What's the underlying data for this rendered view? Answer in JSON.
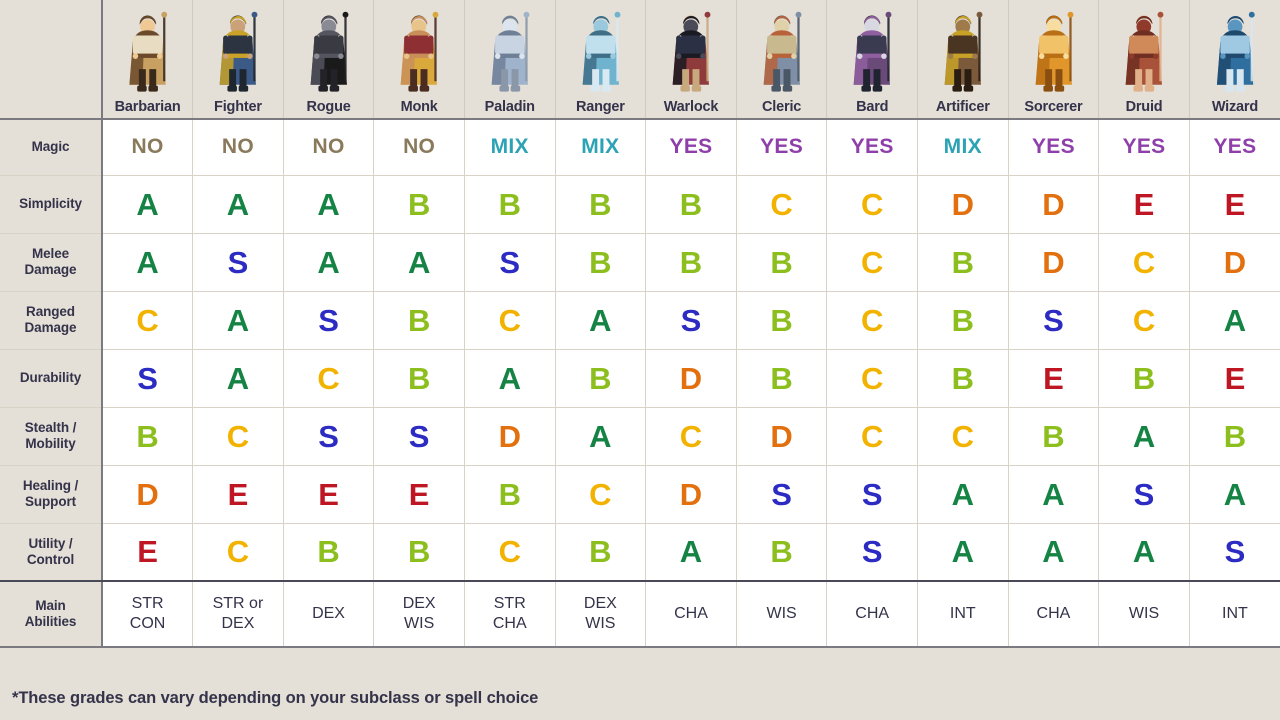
{
  "footnote": "*These grades can vary depending on your subclass or spell choice",
  "row_header_label": "",
  "classes": [
    {
      "name": "Barbarian",
      "icon": "barbarian-portrait"
    },
    {
      "name": "Fighter",
      "icon": "fighter-portrait"
    },
    {
      "name": "Rogue",
      "icon": "rogue-portrait"
    },
    {
      "name": "Monk",
      "icon": "monk-portrait"
    },
    {
      "name": "Paladin",
      "icon": "paladin-portrait"
    },
    {
      "name": "Ranger",
      "icon": "ranger-portrait"
    },
    {
      "name": "Warlock",
      "icon": "warlock-portrait"
    },
    {
      "name": "Cleric",
      "icon": "cleric-portrait"
    },
    {
      "name": "Bard",
      "icon": "bard-portrait"
    },
    {
      "name": "Artificer",
      "icon": "artificer-portrait"
    },
    {
      "name": "Sorcerer",
      "icon": "sorcerer-portrait"
    },
    {
      "name": "Druid",
      "icon": "druid-portrait"
    },
    {
      "name": "Wizard",
      "icon": "wizard-portrait"
    }
  ],
  "row_labels": {
    "magic": "Magic",
    "simplicity": "Simplicity",
    "melee": [
      "Melee",
      "Damage"
    ],
    "ranged": [
      "Ranged",
      "Damage"
    ],
    "durability": "Durability",
    "stealth": [
      "Stealth /",
      "Mobility"
    ],
    "healing": [
      "Healing /",
      "Support"
    ],
    "utility": [
      "Utility /",
      "Control"
    ],
    "abilities": [
      "Main",
      "Abilities"
    ]
  },
  "value_colors": {
    "S": "#2c2cc2",
    "A": "#158344",
    "B": "#8cbf1e",
    "C": "#f2b300",
    "D": "#e2700e",
    "E": "#be1622",
    "NO": "#8a7a5c",
    "MIX": "#2ba3b5",
    "YES": "#8e3faa"
  },
  "chart_data": {
    "type": "table",
    "title": "D&D Class Comparison Grades",
    "categories": [
      "Barbarian",
      "Fighter",
      "Rogue",
      "Monk",
      "Paladin",
      "Ranger",
      "Warlock",
      "Cleric",
      "Bard",
      "Artificer",
      "Sorcerer",
      "Druid",
      "Wizard"
    ],
    "rows": [
      {
        "label": "Magic",
        "values": [
          "NO",
          "NO",
          "NO",
          "NO",
          "MIX",
          "MIX",
          "YES",
          "YES",
          "YES",
          "MIX",
          "YES",
          "YES",
          "YES"
        ]
      },
      {
        "label": "Simplicity",
        "values": [
          "A",
          "A",
          "A",
          "B",
          "B",
          "B",
          "B",
          "C",
          "C",
          "D",
          "D",
          "E",
          "E"
        ]
      },
      {
        "label": "Melee Damage",
        "values": [
          "A",
          "S",
          "A",
          "A",
          "S",
          "B",
          "B",
          "B",
          "C",
          "B",
          "D",
          "C",
          "D"
        ]
      },
      {
        "label": "Ranged Damage",
        "values": [
          "C",
          "A",
          "S",
          "B",
          "C",
          "A",
          "S",
          "B",
          "C",
          "B",
          "S",
          "C",
          "A"
        ]
      },
      {
        "label": "Durability",
        "values": [
          "S",
          "A",
          "C",
          "B",
          "A",
          "B",
          "D",
          "B",
          "C",
          "B",
          "E",
          "B",
          "E"
        ]
      },
      {
        "label": "Stealth / Mobility",
        "values": [
          "B",
          "C",
          "S",
          "S",
          "D",
          "A",
          "C",
          "D",
          "C",
          "C",
          "B",
          "A",
          "B"
        ]
      },
      {
        "label": "Healing / Support",
        "values": [
          "D",
          "E",
          "E",
          "E",
          "B",
          "C",
          "D",
          "S",
          "S",
          "A",
          "A",
          "S",
          "A"
        ]
      },
      {
        "label": "Utility / Control",
        "values": [
          "E",
          "C",
          "B",
          "B",
          "C",
          "B",
          "A",
          "B",
          "S",
          "A",
          "A",
          "A",
          "S"
        ]
      },
      {
        "label": "Main Abilities",
        "values": [
          [
            "STR",
            "CON"
          ],
          [
            "STR or",
            "DEX"
          ],
          [
            "DEX"
          ],
          [
            "DEX",
            "WIS"
          ],
          [
            "STR",
            "CHA"
          ],
          [
            "DEX",
            "WIS"
          ],
          [
            "CHA"
          ],
          [
            "WIS"
          ],
          [
            "CHA"
          ],
          [
            "INT"
          ],
          [
            "CHA"
          ],
          [
            "WIS"
          ],
          [
            "INT"
          ]
        ]
      }
    ],
    "grade_scale": [
      "S",
      "A",
      "B",
      "C",
      "D",
      "E"
    ],
    "magic_scale": [
      "NO",
      "MIX",
      "YES"
    ],
    "note": "*These grades can vary depending on your subclass or spell choice"
  }
}
